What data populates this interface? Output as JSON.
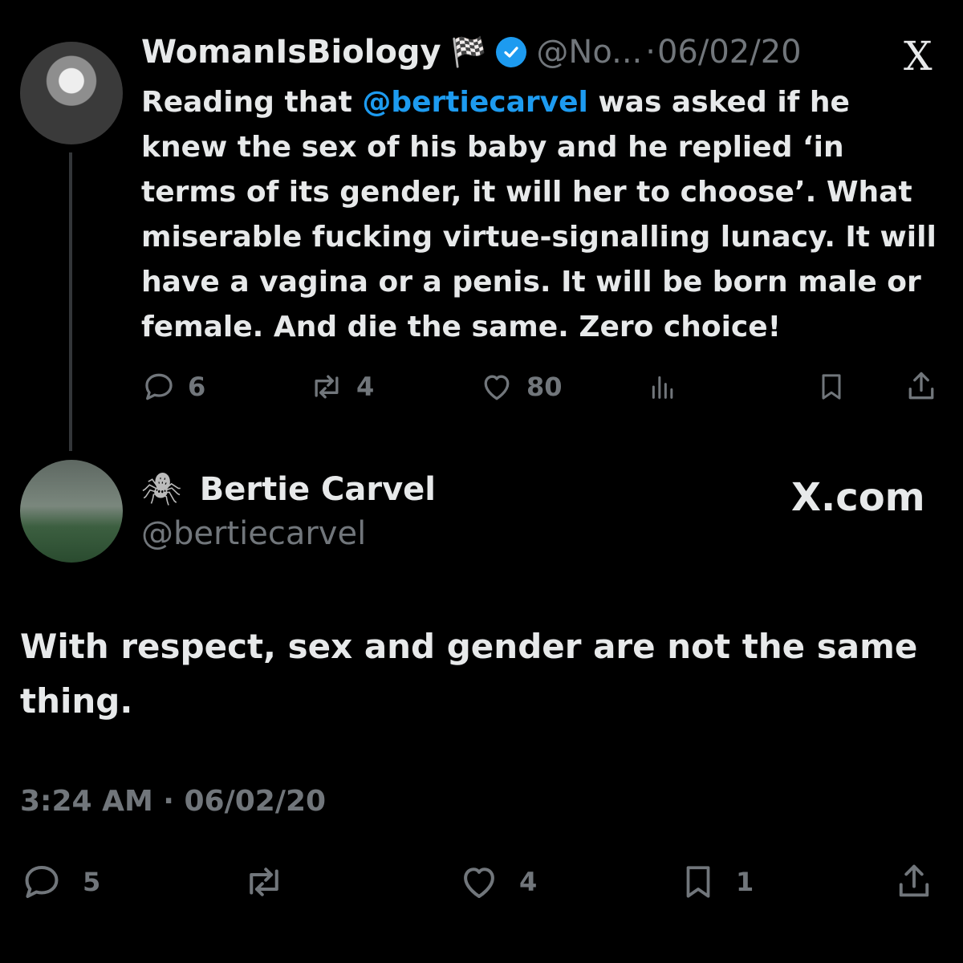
{
  "parent_tweet": {
    "author_name": "WomanIsBiology",
    "flag_icon": "🏁",
    "handle": "@No...",
    "separator": "·",
    "date": "06/02/20",
    "text_before": "Reading that ",
    "mention": "@bertiecarvel",
    "text_after": " was asked if he knew the sex of his baby and he replied ‘in terms of its gender, it will her to choose’. What miserable fucking virtue-signalling lunacy. It will have a vagina or a penis. It will be born male or female. And die the same. Zero choice!",
    "replies": "6",
    "reposts": "4",
    "likes": "80"
  },
  "x_logo": "X",
  "reply_tweet": {
    "spider_icon": "🕷",
    "author_name": "Bertie Carvel",
    "handle": "@bertiecarvel",
    "source": "X.com",
    "text": "With respect, sex and gender are not the same thing.",
    "time": "3:24 AM · 06/02/20",
    "replies": "5",
    "likes": "4",
    "bookmarks": "1"
  },
  "colors": {
    "background": "#000000",
    "text": "#e7e9ea",
    "muted": "#71767b",
    "link": "#1d9bf0"
  }
}
